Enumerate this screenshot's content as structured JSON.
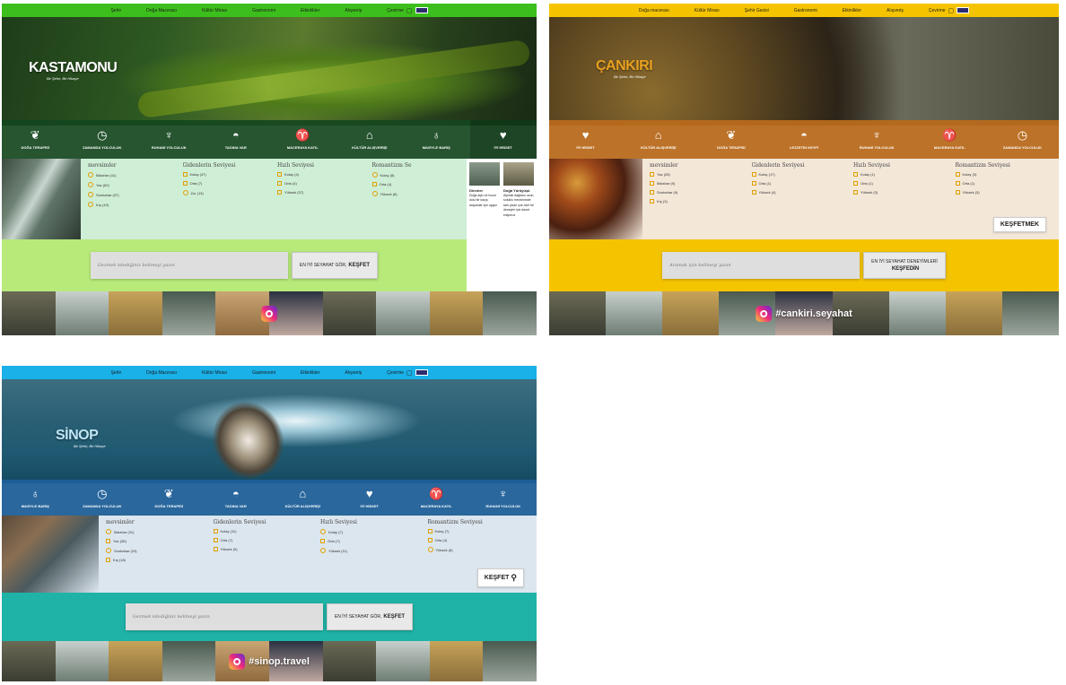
{
  "kastamonu": {
    "nav": [
      "Şehir",
      "Doğa Macerası",
      "Kültür Mirası",
      "Gastronomi",
      "Etkinlikler",
      "Alışveriş"
    ],
    "nav_lang": "Çevirme",
    "logo": "KASTAMONU",
    "tagline": "Bir Şehir, Bir Hikaye",
    "categories": [
      "DOĞA TERAPİSİ",
      "ZAMANDA YOLCULUK",
      "RUHANİ YOLCULUK",
      "TADINA VAR",
      "MACERAYA KATIL",
      "KÜLTÜR ALIŞVERİŞİ",
      "MAVİYLE BARIŞ",
      "İYİ HİSSET"
    ],
    "filters": [
      {
        "title": "mevsimler",
        "options": [
          "İlkbahar (41)",
          "Yaz (62)",
          "Sonbahar (37)",
          "Kış (19)"
        ]
      },
      {
        "title": "Gidenlerin Seviyesi",
        "options": [
          "Kolay (47)",
          "Orta (7)",
          "Zor (13)"
        ]
      },
      {
        "title": "Hızlı Seviyesi",
        "options": [
          "Kolay (4)",
          "Orta (4)",
          "Yüksek (37)"
        ]
      },
      {
        "title": "Romantizm Se",
        "options": [
          "Kolay (8)",
          "Orta (4)",
          "Yüksek (8)"
        ]
      }
    ],
    "sidebar_cards": [
      {
        "title": "Direnler",
        "text": "Doğa aşkı ve huzur dolu bir kaçış arayanlar için uygun"
      },
      {
        "title": "Doğa Yürüyüşü",
        "text": "Alpinist dağların uzun soluklu mevsiminde tadı çıkan çok özel bir deneyim için davet ediyoruz"
      }
    ],
    "search_placeholder": "Gezmek istediğiniz kelimeyi yazın",
    "search_button_prefix": "EN İYİ SEYAHAT GÖR,",
    "search_button_bold": "KEŞFET"
  },
  "cankiri": {
    "nav": [
      "Doğa macerası",
      "Kültür Mirası",
      "Şehir Gezisi",
      "Gastronomi",
      "Etkinlikler",
      "Alışveriş"
    ],
    "nav_lang": "Çevirme",
    "logo": "ÇANKIRI",
    "tagline": "Bir Şehir, Bir Hikaye",
    "categories": [
      "İYİ HİSSET",
      "KÜLTÜR ALIŞVERİŞİ",
      "DOĞA TERAPİSİ",
      "LEZZETİN KEYFİ",
      "RUHANİ YOLCULUK",
      "MACERAYA KATIL",
      "ZAMANDA YOLCULUK"
    ],
    "filters": [
      {
        "title": "mevsimler",
        "options": [
          "Yaz (28)",
          "İlkbahar (9)",
          "Sonbahar (9)",
          "Kış (3)"
        ]
      },
      {
        "title": "Gidenlerin Seviyesi",
        "options": [
          "Kolay (17)",
          "Orta (1)",
          "Yüksek (4)"
        ]
      },
      {
        "title": "Hızlı Seviyesi",
        "options": [
          "Kolay (1)",
          "Orta (1)",
          "Yüksek (3)"
        ]
      },
      {
        "title": "Romantizm Seviyesi",
        "options": [
          "Kolay (3)",
          "Orta (1)",
          "Yüksek (3)"
        ]
      }
    ],
    "explore_label": "KEŞFETMEK",
    "search_placeholder": "Aramak için kelimeyi yazın",
    "search_button_line1": "EN İYİ SEYAHAT DENEYİMLERİ",
    "search_button_line2": "KEŞFEDİN",
    "insta_handle": "#cankiri.seyahat"
  },
  "sinop": {
    "nav": [
      "Şehir",
      "Doğa Macerası",
      "Kültür Mirası",
      "Gastronomi",
      "Etkinlikler",
      "Alışveriş"
    ],
    "nav_lang": "Çevirme",
    "logo": "SİNOP",
    "tagline": "Bir Şehir, Bir Hikaye",
    "categories": [
      "MAVİYLE BARIŞ",
      "ZAMANDA YOLCULUK",
      "DOĞA TERAPİSİ",
      "TADINA VAR",
      "KÜLTÜR ALIŞVERİŞİ",
      "İYİ HİSSET",
      "MACERAYA KATIL",
      "RUHANİ YOLCULUK"
    ],
    "filters": [
      {
        "title": "mevsimler",
        "options": [
          "İlkbahar (31)",
          "Yaz (36)",
          "Sonbahar (23)",
          "Kış (18)"
        ]
      },
      {
        "title": "Gidenlerin Seviyesi",
        "options": [
          "Kolay (11)",
          "Orta (7)",
          "Yüksek (9)"
        ]
      },
      {
        "title": "Hızlı Seviyesi",
        "options": [
          "Kolay (7)",
          "Orta (7)",
          "Yüksek (11)"
        ]
      },
      {
        "title": "Romantizm Seviyesi",
        "options": [
          "Kolay (7)",
          "Orta (4)",
          "Yüksek (8)"
        ]
      }
    ],
    "explore_label": "KEŞFET",
    "search_placeholder": "Gezmek istediğiniz kelimeyi yazın",
    "search_button_prefix": "EN İYİ SEYAHAT GÖR,",
    "search_button_bold": "KEŞFET",
    "insta_handle": "#sinop.travel"
  },
  "colors": {
    "kastamonu_accent": "#3cbf1c",
    "kastamonu_listing": "#cfeed6",
    "kastamonu_search": "#b8ea7a",
    "cankiri_accent": "#f5c400",
    "cankiri_catbar": "#b86a1c",
    "cankiri_listing": "#f3e7d8",
    "sinop_accent": "#1ab0e8",
    "sinop_catbar": "#1e5f98",
    "sinop_listing": "#dce6ee",
    "sinop_search": "#1fb3a7"
  },
  "icons": {
    "categories": [
      "leaf-icon",
      "clock-icon",
      "wheat-icon",
      "bowl-icon",
      "footprint-icon",
      "mosque-icon",
      "water-drop-icon",
      "heart-icon"
    ],
    "search": "magnifier-icon",
    "instagram": "instagram-icon",
    "calendar": "calendar-icon",
    "flag": "flag-icon"
  }
}
